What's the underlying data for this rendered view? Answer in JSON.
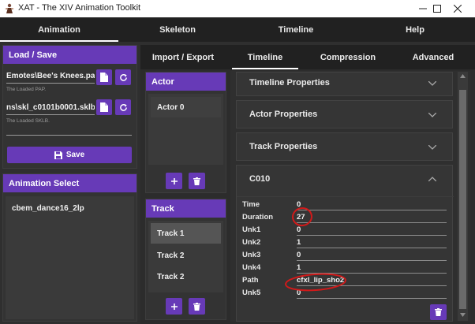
{
  "window": {
    "title": "XAT - The XIV Animation Toolkit",
    "controls": {
      "minimize": "—",
      "maximize": "☐",
      "close": "✕"
    }
  },
  "main_tabs": [
    {
      "label": "Animation",
      "active": true
    },
    {
      "label": "Skeleton",
      "active": false
    },
    {
      "label": "Timeline",
      "active": false
    },
    {
      "label": "Help",
      "active": false
    }
  ],
  "load_save": {
    "header": "Load / Save",
    "pap_path": "Emotes\\Bee's Knees.pap",
    "pap_hint": "The Loaded PAP.",
    "sklb_path": "ns\\skl_c0101b0001.sklb",
    "sklb_hint": "The Loaded SKLB.",
    "save_label": "Save"
  },
  "animation_select": {
    "header": "Animation Select",
    "items": [
      "cbem_dance16_2lp"
    ]
  },
  "sub_tabs": [
    {
      "label": "Import / Export",
      "active": false
    },
    {
      "label": "Timeline",
      "active": true
    },
    {
      "label": "Compression",
      "active": false
    },
    {
      "label": "Advanced",
      "active": false
    }
  ],
  "actor": {
    "header": "Actor",
    "items": [
      "Actor 0"
    ]
  },
  "track": {
    "header": "Track",
    "items": [
      "Track 1",
      "Track 2",
      "Track 2"
    ]
  },
  "properties": {
    "timeline_props": "Timeline Properties",
    "actor_props": "Actor Properties",
    "track_props": "Track Properties"
  },
  "c010": {
    "header": "C010",
    "fields": [
      {
        "label": "Time",
        "value": "0"
      },
      {
        "label": "Duration",
        "value": "27"
      },
      {
        "label": "Unk1",
        "value": "0"
      },
      {
        "label": "Unk2",
        "value": "1"
      },
      {
        "label": "Unk3",
        "value": "0"
      },
      {
        "label": "Unk4",
        "value": "1"
      },
      {
        "label": "Path",
        "value": "cfxl_lip_sho2"
      },
      {
        "label": "Unk5",
        "value": "0"
      }
    ]
  },
  "colors": {
    "accent": "#673ab7",
    "annotation": "#d11a1a"
  }
}
